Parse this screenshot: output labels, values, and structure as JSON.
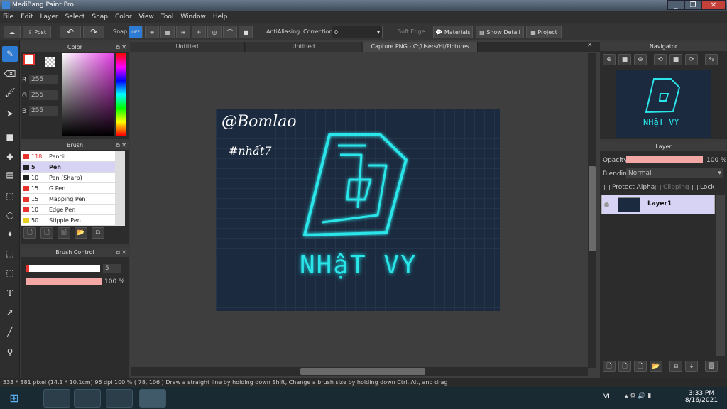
{
  "window": {
    "title": "MediBang Paint Pro",
    "minimize": "_",
    "restore": "❐",
    "close": "✕"
  },
  "menu": [
    "File",
    "Edit",
    "Layer",
    "Select",
    "Snap",
    "Color",
    "View",
    "Tool",
    "Window",
    "Help"
  ],
  "toolbar": {
    "post": "Post",
    "snap": "Snap",
    "snap_off": "OFF",
    "antialiasing": "AntiAliasing",
    "correction": "Correction",
    "correction_value": "0",
    "soft_edge": "Soft Edge",
    "materials": "Materials",
    "show_detail": "Show Detail",
    "project": "Project"
  },
  "color_panel": {
    "title": "Color",
    "r_label": "R",
    "g_label": "G",
    "b_label": "B",
    "r": "255",
    "g": "255",
    "b": "255",
    "primary": "#ffffff",
    "secondary": "#ff0000"
  },
  "brush_panel": {
    "title": "Brush",
    "items": [
      {
        "size": "118",
        "name": "Pencil",
        "color": "#e8322e"
      },
      {
        "size": "5",
        "name": "Pen",
        "color": "#222222"
      },
      {
        "size": "10",
        "name": "Pen (Sharp)",
        "color": "#222222"
      },
      {
        "size": "15",
        "name": "G Pen",
        "color": "#e8322e"
      },
      {
        "size": "15",
        "name": "Mapping Pen",
        "color": "#e8322e"
      },
      {
        "size": "10",
        "name": "Edge Pen",
        "color": "#e8322e"
      },
      {
        "size": "50",
        "name": "Stipple Pen",
        "color": "#e8d022"
      }
    ]
  },
  "brush_control": {
    "title": "Brush Control",
    "size": "5",
    "opacity": "100 %",
    "size_fraction": 0.05,
    "opacity_fraction": 1.0
  },
  "tabs": [
    "Untitled",
    "Untitled",
    "Capture.PNG - C:/Users/Hi/Pictures"
  ],
  "artwork": {
    "handle": "@Bomlao",
    "sub": "#nhất7",
    "title": "NHậT VY",
    "accent": "#19e3e8"
  },
  "navigator": {
    "title": "Navigator"
  },
  "layer_panel": {
    "title": "Layer",
    "opacity_label": "Opacity",
    "opacity": "100 %",
    "blending_label": "Blending",
    "blending": "Normal",
    "protect_alpha": "Protect Alpha",
    "clipping": "Clipping",
    "lock": "Lock",
    "layers": [
      {
        "name": "Layer1"
      }
    ]
  },
  "status": "533 * 381 pixel   (14.1 * 10.1cm)   96 dpi   100 %   ( 78, 106 )   Draw a straight line by holding down Shift, Change a brush size by holding down Ctrl, Alt, and drag",
  "taskbar": {
    "lang": "VI",
    "time": "3:33 PM",
    "date": "8/16/2021"
  }
}
